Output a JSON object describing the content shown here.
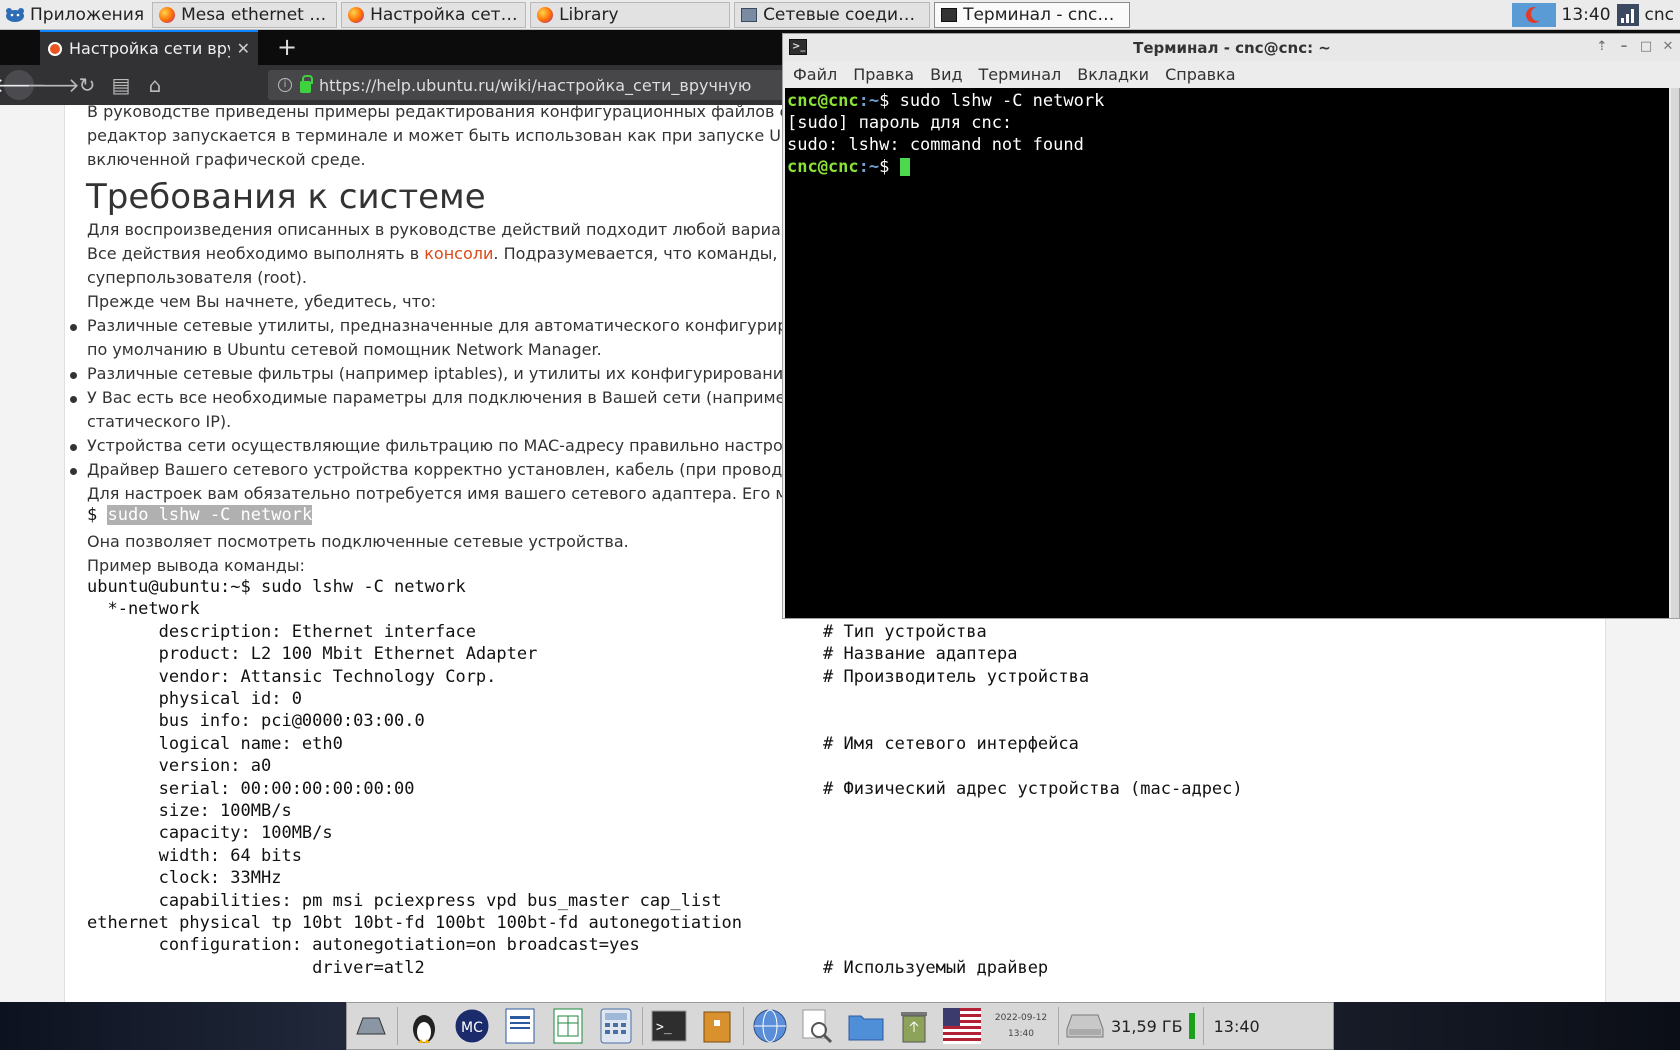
{
  "top_panel": {
    "apps_label": "Приложения",
    "tasks": [
      {
        "label": "Mesa ethernet setu...",
        "icon": "firefox-icon"
      },
      {
        "label": "Настройка сети в...",
        "icon": "firefox-icon"
      },
      {
        "label": "Library",
        "icon": "firefox-icon"
      },
      {
        "label": "Сетевые соедине...",
        "icon": "network-connections-icon"
      },
      {
        "label": "Терминал - cnc@c...",
        "icon": "terminal-icon"
      }
    ],
    "clock": "13:40",
    "user": "cnc"
  },
  "browser": {
    "tab_title": "Настройка сети вручную",
    "url": "https://help.ubuntu.ru/wiki/настройка_сети_вручную"
  },
  "page": {
    "intro_lines": [
      "В руководстве приведены примеры редактирования конфигурационных файлов с",
      "редактор запускается в терминале и может быть использован как при запуске Ubu",
      "включенной графической среде."
    ],
    "heading": "Требования к системе",
    "req_1": "Для воспроизведения описанных в руководстве действий подходит любой вариан",
    "req_2_pre": "Все действия необходимо выполнять в ",
    "req_2_link": "консоли",
    "req_2_post": ". Подразумевается, что команды, ",
    "req_3": "суперпользователя (root).",
    "req_4": "Прежде чем Вы начнете, убедитесь, что:",
    "bullets": [
      "Различные сетевые утилиты, предназначенные для автоматического конфигуриро",
      "по умолчанию в Ubuntu сетевой помощник Network Manager.",
      "Различные сетевые фильтры (например iptables), и утилиты их конфигурирования",
      "У Вас есть все необходимые параметры для подключения в Вашей сети (наприме",
      "статического IP).",
      "Устройства сети осуществляющие фильтрацию по MAC-адресу правильно настроен",
      "Драйвер Вашего сетевого устройства корректно установлен, кабель (при проводн"
    ],
    "adapter_note": "Для настроек вам обязательно потребуется имя вашего сетевого адаптера. Его мо",
    "cmd_prompt": "$ ",
    "cmd": "sudo lshw -C network",
    "cmd_desc": "Она позволяет посмотреть подключенные сетевые устройства.",
    "example_label": "Пример вывода команды:",
    "output_lines": [
      "ubuntu@ubuntu:~$ sudo lshw -C network",
      "  *-network",
      "       description: Ethernet interface",
      "       product: L2 100 Mbit Ethernet Adapter",
      "       vendor: Attansic Technology Corp.",
      "       physical id: 0",
      "       bus info: pci@0000:03:00.0",
      "       logical name: eth0",
      "       version: a0",
      "       serial: 00:00:00:00:00:00",
      "       size: 100MB/s",
      "       capacity: 100MB/s",
      "       width: 64 bits",
      "       clock: 33MHz",
      "       capabilities: pm msi pciexpress vpd bus_master cap_list",
      "ethernet physical tp 10bt 10bt-fd 100bt 100bt-fd autonegotiation",
      "       configuration: autonegotiation=on broadcast=yes",
      "                      driver=atl2"
    ],
    "comments": [
      "",
      "",
      "# Тип устройства",
      "# Название адаптера",
      "# Производитель устройства",
      "",
      "",
      "# Имя сетевого интерфейса",
      "",
      "# Физический адрес устройства (mac-адрес)",
      "",
      "",
      "",
      "",
      "",
      "",
      "",
      "# Используемый драйвер"
    ]
  },
  "terminal": {
    "title": "Терминал - cnc@cnc: ~",
    "menu": [
      "Файл",
      "Правка",
      "Вид",
      "Терминал",
      "Вкладки",
      "Справка"
    ],
    "prompt_user": "cnc@cnc",
    "prompt_path": ":~",
    "prompt_sym": "$ ",
    "command": "sudo lshw -C network",
    "line2": "[sudo] пароль для cnc:",
    "line3": "sudo: lshw: command not found"
  },
  "taskbar": {
    "date": "2022-09-12",
    "time_small": "13:40",
    "disk_free": "31,59 ГБ",
    "clock": "13:40"
  }
}
